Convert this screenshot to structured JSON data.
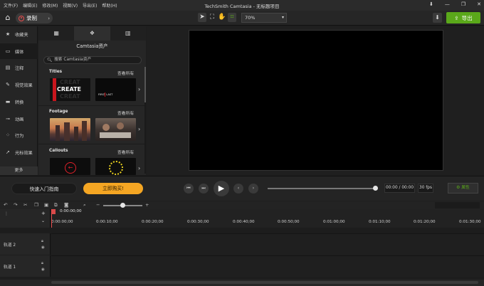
{
  "window": {
    "title": "TechSmith Camtasia - 无标题项目",
    "menu": [
      "文件(F)",
      "编辑(E)",
      "修改(M)",
      "视图(V)",
      "导出(E)",
      "帮助(H)"
    ],
    "controls": [
      "⬇",
      "—",
      "❐",
      "✕"
    ]
  },
  "toolbar": {
    "record_label": "录制",
    "zoom_value": "70%",
    "export_label": "导出",
    "accent_color": "#5aa81a"
  },
  "sidebar": {
    "items": [
      {
        "label": "收藏夹",
        "icon": "star-icon"
      },
      {
        "label": "媒体",
        "icon": "media-icon"
      },
      {
        "label": "注释",
        "icon": "annotation-icon"
      },
      {
        "label": "视觉效果",
        "icon": "visual-effects-icon"
      },
      {
        "label": "转换",
        "icon": "transition-icon"
      },
      {
        "label": "动画",
        "icon": "animation-icon"
      },
      {
        "label": "行为",
        "icon": "behavior-icon"
      },
      {
        "label": "光标效果",
        "icon": "cursor-effects-icon"
      }
    ],
    "more_label": "更多"
  },
  "library": {
    "heading": "Camtasia资产",
    "search_placeholder": "搜索 Camtasia资产",
    "sections": [
      {
        "title": "Titles",
        "link": "查看所有",
        "thumb_text": "CREATE",
        "thumb_text2": "FIRST LAST"
      },
      {
        "title": "Footage",
        "link": "查看所有"
      },
      {
        "title": "Callouts",
        "link": "查看所有"
      }
    ]
  },
  "transport": {
    "guide_label": "快速入门指南",
    "buy_label": "立即购买!",
    "time_display": "00:00 / 00:00",
    "fps": "30 fps",
    "properties_label": "属性"
  },
  "timeline": {
    "playhead_time": "0:00:00;00",
    "ruler_labels": [
      "0:00:00;00",
      "0:00:10;00",
      "0:00:20;00",
      "0:00:30;00",
      "0:00:40;00",
      "0:00:50;00",
      "0:01:00;00",
      "0:01:10;00",
      "0:01:20;00",
      "0:01:30;00"
    ],
    "tracks": [
      "轨道 2",
      "轨道 1"
    ]
  }
}
